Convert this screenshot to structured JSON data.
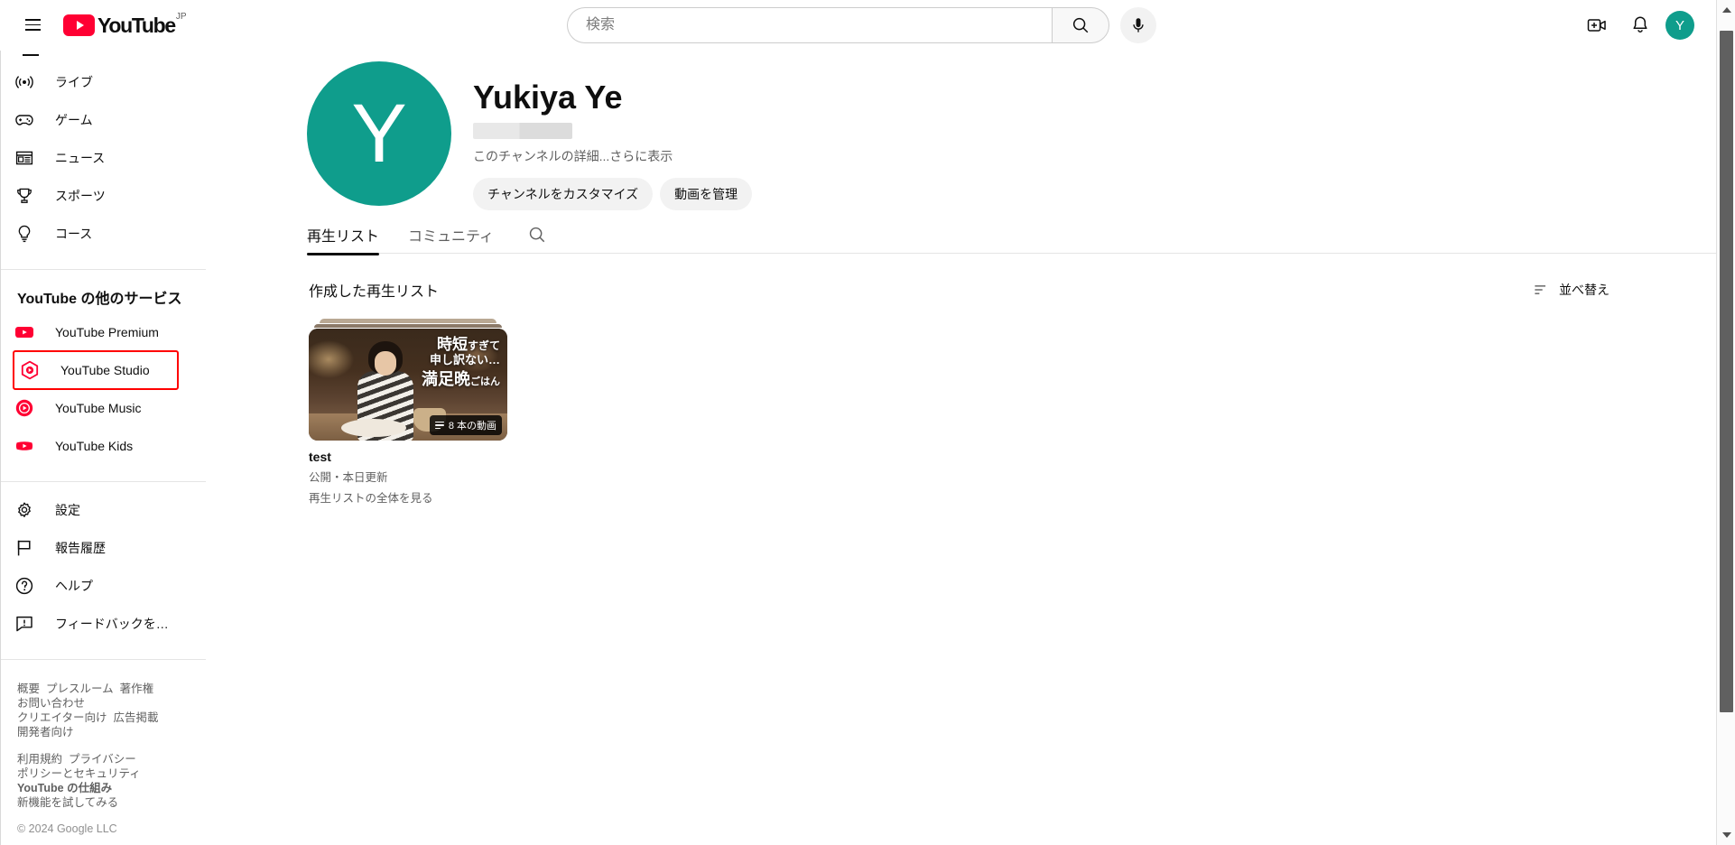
{
  "masthead": {
    "menu_label": "ガイド メニュー",
    "logo_text": "YouTube",
    "logo_country": "JP",
    "search_placeholder": "検索",
    "search_value": "",
    "search_button_label": "検索",
    "mic_label": "音声で検索",
    "create_label": "作成",
    "notifications_label": "通知",
    "avatar_initial": "Y"
  },
  "sidebar": {
    "primary_items": [
      {
        "label": "ライブ",
        "icon": "live-icon"
      },
      {
        "label": "ゲーム",
        "icon": "gaming-icon"
      },
      {
        "label": "ニュース",
        "icon": "news-icon"
      },
      {
        "label": "スポーツ",
        "icon": "sports-icon"
      },
      {
        "label": "コース",
        "icon": "courses-icon"
      }
    ],
    "more_section_title": "YouTube の他のサービス",
    "more_items": [
      {
        "label": "YouTube Premium",
        "icon": "youtube-premium-icon",
        "highlighted": false
      },
      {
        "label": "YouTube Studio",
        "icon": "youtube-studio-icon",
        "highlighted": true
      },
      {
        "label": "YouTube Music",
        "icon": "youtube-music-icon",
        "highlighted": false
      },
      {
        "label": "YouTube Kids",
        "icon": "youtube-kids-icon",
        "highlighted": false
      }
    ],
    "settings_items": [
      {
        "label": "設定",
        "icon": "gear-icon"
      },
      {
        "label": "報告履歴",
        "icon": "flag-icon"
      },
      {
        "label": "ヘルプ",
        "icon": "help-icon"
      },
      {
        "label": "フィードバックを…",
        "icon": "feedback-icon"
      }
    ],
    "footer_group_1": [
      "概要",
      "プレスルーム",
      "著作権",
      "お問い合わせ",
      "クリエイター向け",
      "広告掲載",
      "開発者向け"
    ],
    "footer_group_2": [
      "利用規約",
      "プライバシー",
      "ポリシーとセキュリティ",
      "YouTube の仕組み",
      "新機能を試してみる"
    ],
    "footer_bold_item": "YouTube の仕組み",
    "copyright": "© 2024 Google LLC"
  },
  "channel": {
    "avatar_initial": "Y",
    "avatar_color": "#0f9d8c",
    "name": "Yukiya Ye",
    "handle_redacted": true,
    "description": "このチャンネルの詳細",
    "description_more": "...さらに表示",
    "buttons": [
      {
        "label": "チャンネルをカスタマイズ"
      },
      {
        "label": "動画を管理"
      }
    ],
    "tabs": [
      {
        "label": "再生リスト",
        "active": true
      },
      {
        "label": "コミュニティ",
        "active": false
      }
    ],
    "tab_search_icon": "search-icon"
  },
  "playlists_section": {
    "title": "作成した再生リスト",
    "sort_label": "並べ替え",
    "sort_icon": "sort-icon",
    "items": [
      {
        "title": "test",
        "meta": "公開・本日更新",
        "link": "再生リストの全体を見る",
        "video_count_badge": "8 本の動画",
        "thumbnail_text_line1": "時短",
        "thumbnail_text_line1_small": "すぎて",
        "thumbnail_text_line2": "申し訳ない…",
        "thumbnail_text_line3": "満足晩",
        "thumbnail_text_line3_small": "ごはん"
      }
    ]
  },
  "colors": {
    "brand_red": "#ff0033",
    "highlight_red": "#ff0000",
    "avatar_teal": "#0f9d8c",
    "text_primary": "#0f0f0f",
    "text_secondary": "#606060"
  }
}
